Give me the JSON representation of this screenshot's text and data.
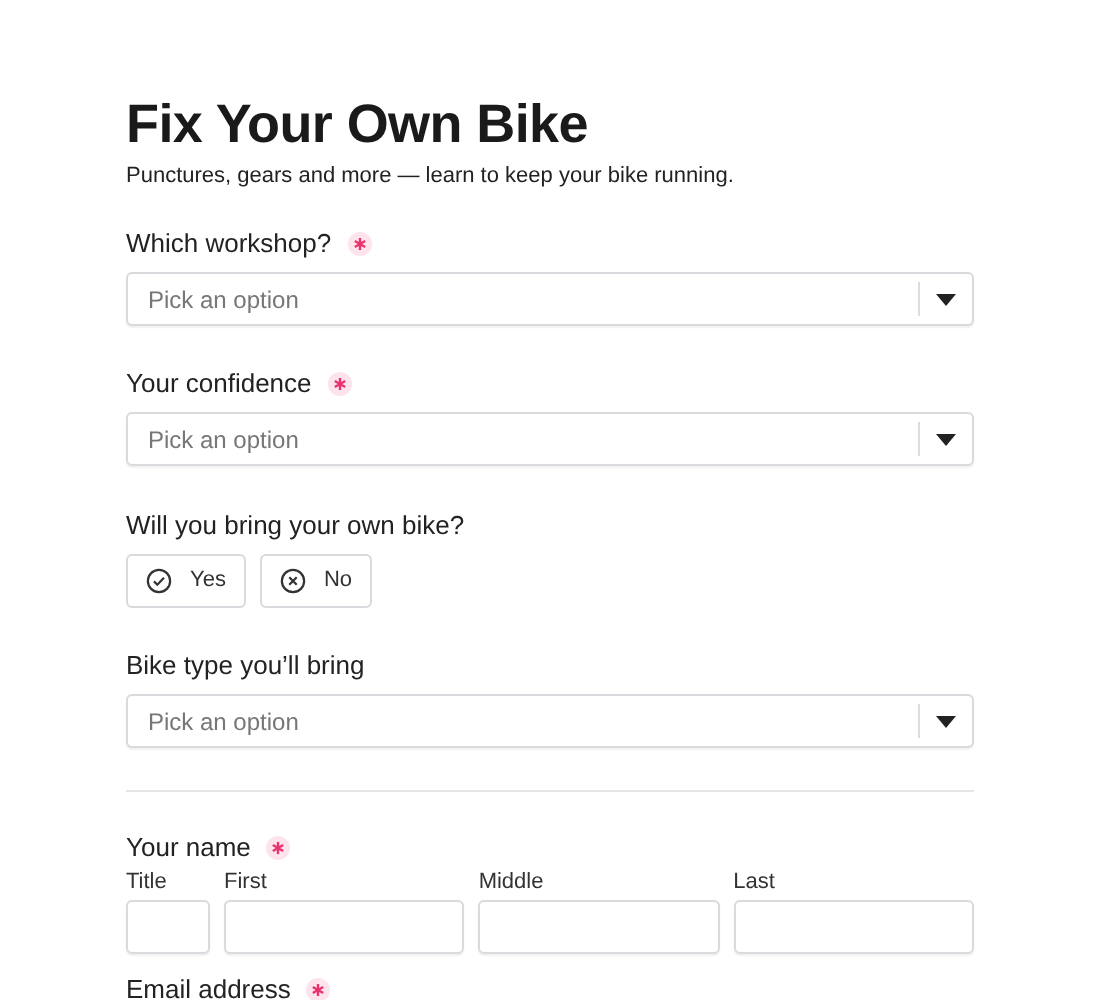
{
  "title": "Fix Your Own Bike",
  "subtitle": "Punctures, gears and more — learn to keep your bike running.",
  "fields": [
    {
      "kind": "select",
      "label": "Which workshop?",
      "required": true,
      "placeholder": "Pick an option"
    },
    {
      "kind": "select",
      "label": "Your confidence",
      "required": true,
      "placeholder": "Pick an option"
    },
    {
      "kind": "choice",
      "label": "Will you bring your own bike?",
      "required": false,
      "options": [
        {
          "label": "Yes",
          "selected": false
        },
        {
          "label": "No",
          "selected": false
        }
      ]
    },
    {
      "kind": "select",
      "label": "Bike type you’ll bring",
      "required": false,
      "placeholder": "Pick an option"
    },
    {
      "kind": "divider"
    },
    {
      "kind": "name",
      "label": "Your name",
      "required": true,
      "parts": [
        "Title",
        "First",
        "Middle",
        "Last"
      ]
    },
    {
      "kind": "text",
      "label": "Email address",
      "required": true
    }
  ]
}
